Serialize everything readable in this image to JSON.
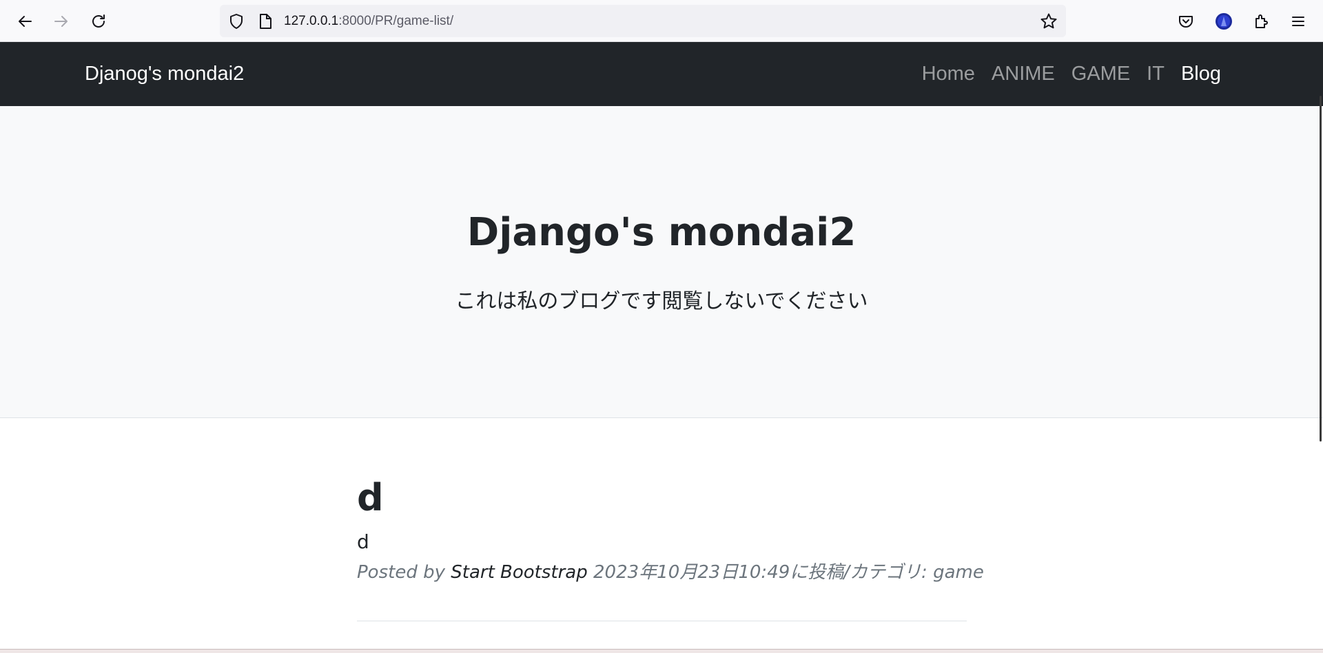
{
  "browser": {
    "url_host": "127.0.0.1",
    "url_rest": ":8000/PR/game-list/",
    "icons": [
      "back-arrow-icon",
      "forward-arrow-icon",
      "reload-icon",
      "shield-icon",
      "page-icon",
      "star-icon",
      "pocket-icon",
      "account-avatar-icon",
      "extensions-icon",
      "menu-icon"
    ]
  },
  "navbar": {
    "brand": "Djanog's mondai2",
    "links": [
      {
        "label": "Home",
        "active": false
      },
      {
        "label": "ANIME",
        "active": false
      },
      {
        "label": "GAME",
        "active": false
      },
      {
        "label": "IT",
        "active": false
      },
      {
        "label": "Blog",
        "active": true
      }
    ]
  },
  "header": {
    "title": "Django's mondai2",
    "lead": "これは私のブログです閲覧しないでください"
  },
  "posts": [
    {
      "title": "d",
      "subtitle": "d",
      "meta_prefix": "Posted by ",
      "author": "Start Bootstrap",
      "meta_suffix": " 2023年10月23日10:49に投稿/カテゴリ: game"
    }
  ],
  "colors": {
    "navbar_bg": "#212529",
    "hero_bg": "#f8f9fa",
    "text": "#212529",
    "muted": "#6c757d"
  }
}
